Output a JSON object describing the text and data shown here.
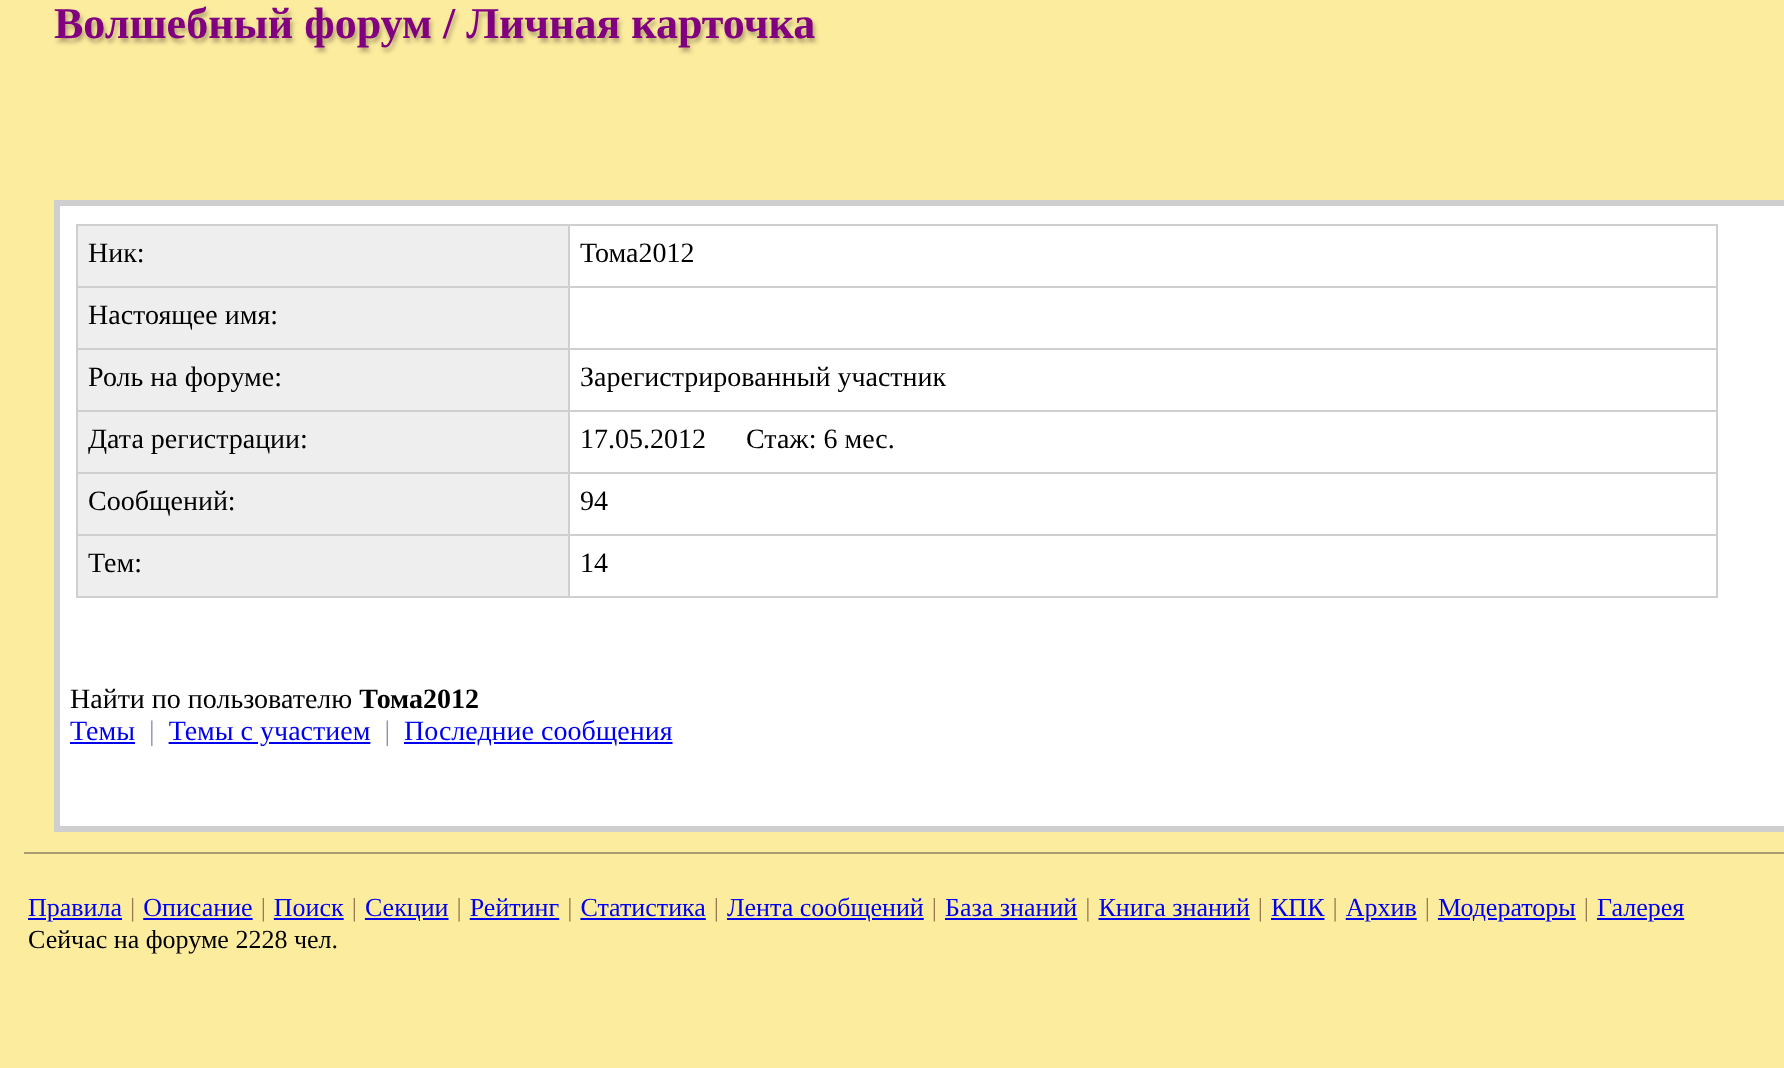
{
  "title": "Волшебный форум / Личная карточка",
  "profile": {
    "rows": [
      {
        "label": "Ник:",
        "value": "Тома2012"
      },
      {
        "label": "Настоящее имя:"
      },
      {
        "label": "Роль на форуме:",
        "value": "Зарегистрированный участник"
      },
      {
        "label": "Дата регистрации:",
        "value": "17.05.2012",
        "extra": "Стаж: 6 мес."
      },
      {
        "label": "Сообщений:",
        "value": "94"
      },
      {
        "label": "Тем:",
        "value": "14"
      }
    ]
  },
  "search": {
    "text": "Найти по пользователю **Тома2012**",
    "links": [
      {
        "kind": "link",
        "label": "Темы"
      },
      {
        "kind": "separator",
        "label": "|"
      },
      {
        "kind": "link",
        "label": "Темы с участием"
      },
      {
        "kind": "separator",
        "label": "|"
      },
      {
        "kind": "link",
        "label": "Последние сообщения"
      }
    ]
  },
  "footer": {
    "links": [
      {
        "kind": "link",
        "label": "Правила"
      },
      {
        "kind": "separator",
        "label": "|"
      },
      {
        "kind": "link",
        "label": "Описание"
      },
      {
        "kind": "separator",
        "label": "|"
      },
      {
        "kind": "link",
        "label": "Поиск"
      },
      {
        "kind": "separator",
        "label": "|"
      },
      {
        "kind": "link",
        "label": "Секции"
      },
      {
        "kind": "separator",
        "label": "|"
      },
      {
        "kind": "link",
        "label": "Рейтинг"
      },
      {
        "kind": "separator",
        "label": "|"
      },
      {
        "kind": "link",
        "label": "Статистика"
      },
      {
        "kind": "separator",
        "label": "|"
      },
      {
        "kind": "link",
        "label": "Лента сообщений"
      },
      {
        "kind": "separator",
        "label": "|"
      },
      {
        "kind": "link",
        "label": "База знаний"
      },
      {
        "kind": "separator",
        "label": "|"
      },
      {
        "kind": "link",
        "label": "Книга знаний"
      },
      {
        "kind": "separator",
        "label": "|"
      },
      {
        "kind": "link",
        "label": "КПК"
      },
      {
        "kind": "separator",
        "label": "|"
      },
      {
        "kind": "link",
        "label": "Архив"
      },
      {
        "kind": "separator",
        "label": "|"
      },
      {
        "kind": "link",
        "label": "Модераторы"
      },
      {
        "kind": "separator",
        "label": "|"
      },
      {
        "kind": "link",
        "label": "Галерея"
      }
    ],
    "online": "Сейчас на форуме 2228 чел."
  }
}
